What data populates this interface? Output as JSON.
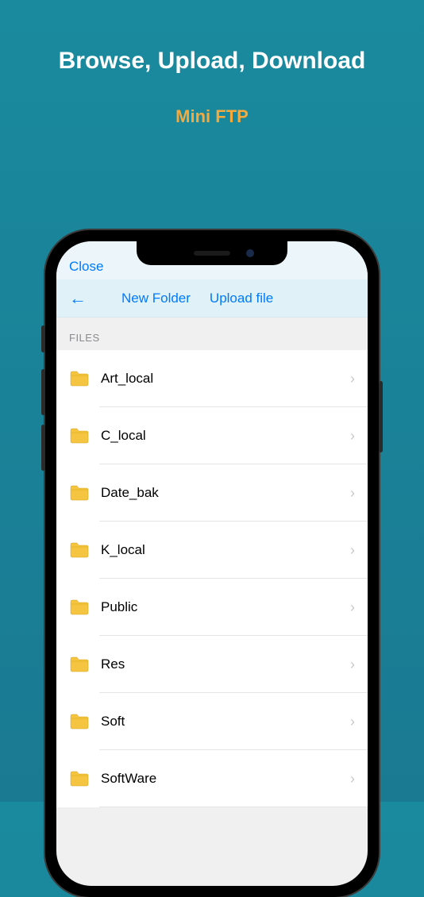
{
  "headline": "Browse, Upload, Download",
  "subtitle": "Mini FTP",
  "topbar": {
    "close_label": "Close"
  },
  "toolbar": {
    "new_folder_label": "New Folder",
    "upload_label": "Upload file"
  },
  "section": {
    "header": "FILES"
  },
  "files": [
    {
      "name": "Art_local"
    },
    {
      "name": "C_local"
    },
    {
      "name": "Date_bak"
    },
    {
      "name": "K_local"
    },
    {
      "name": "Public"
    },
    {
      "name": "Res"
    },
    {
      "name": "Soft"
    },
    {
      "name": "SoftWare"
    }
  ]
}
